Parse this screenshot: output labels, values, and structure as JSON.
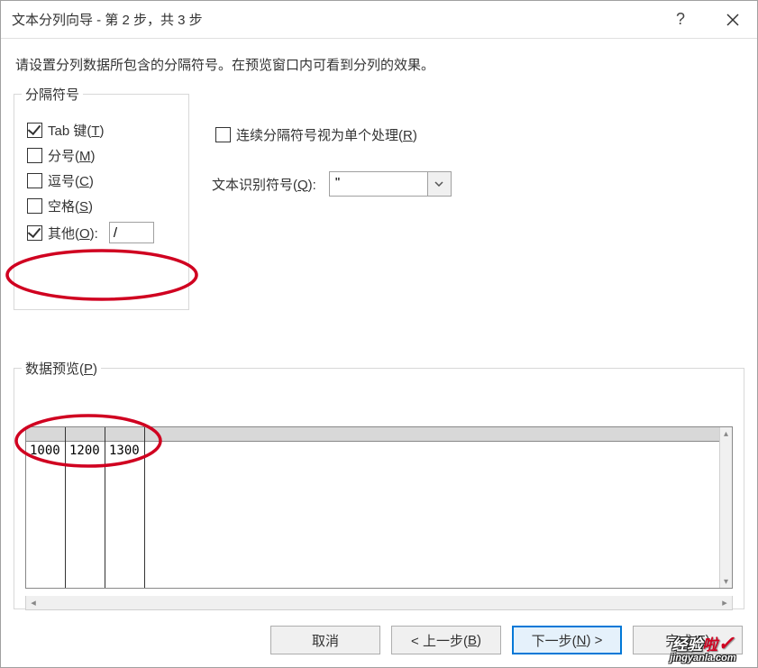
{
  "window": {
    "title": "文本分列向导 - 第 2 步，共 3 步",
    "help": "?",
    "description": "请设置分列数据所包含的分隔符号。在预览窗口内可看到分列的效果。"
  },
  "delimiters": {
    "group_label": "分隔符号",
    "tab": {
      "checked": true,
      "label_pre": "Tab 键(",
      "key": "T",
      "label_post": ")"
    },
    "semicolon": {
      "checked": false,
      "label_pre": "分号(",
      "key": "M",
      "label_post": ")"
    },
    "comma": {
      "checked": false,
      "label_pre": "逗号(",
      "key": "C",
      "label_post": ")"
    },
    "space": {
      "checked": false,
      "label_pre": "空格(",
      "key": "S",
      "label_post": ")"
    },
    "other": {
      "checked": true,
      "label_pre": "其他(",
      "key": "O",
      "label_post": "):",
      "value": "/"
    },
    "consecutive": {
      "checked": false,
      "label_pre": "连续分隔符号视为单个处理(",
      "key": "R",
      "label_post": ")"
    },
    "text_qualifier_label_pre": "文本识别符号(",
    "text_qualifier_key": "Q",
    "text_qualifier_label_post": "):",
    "text_qualifier_value": "\""
  },
  "preview": {
    "label_pre": "数据预览(",
    "key": "P",
    "label_post": ")",
    "columns": [
      "1000",
      "1200",
      "1300"
    ]
  },
  "buttons": {
    "cancel": "取消",
    "back_pre": "< 上一步(",
    "back_key": "B",
    "back_post": ")",
    "next_pre": "下一步(",
    "next_key": "N",
    "next_post": ") >",
    "finish_pre": "完成(",
    "finish_key": "F",
    "finish_post": ")"
  },
  "watermark": {
    "main": "经验",
    "la": "啦",
    "check": "✓",
    "domain": "jingyanla.com"
  },
  "annotation": {
    "color": "#d00020"
  }
}
